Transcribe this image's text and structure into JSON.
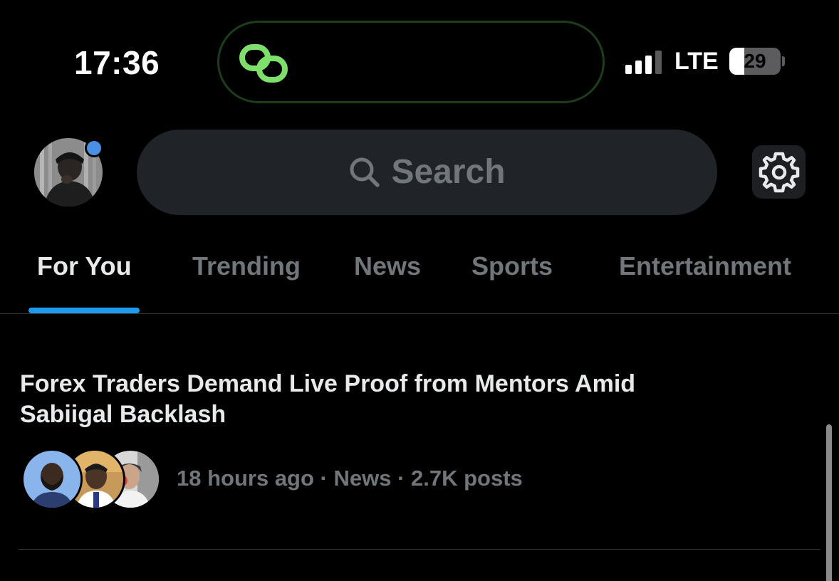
{
  "status_bar": {
    "time": "17:36",
    "network": "LTE",
    "battery_level": "29",
    "battery_fraction": 0.29,
    "signal_bars_active": 3,
    "signal_bars_total": 4,
    "live_activity_icon": "link-icon",
    "live_activity_color": "#7ee06a"
  },
  "header": {
    "avatar_icon": "profile-avatar",
    "notification_dot_color": "#4a90e2",
    "search": {
      "label": "Search",
      "icon": "search-icon"
    },
    "settings_icon": "gear-icon"
  },
  "tabs": {
    "items": [
      {
        "label": "For You",
        "active": true
      },
      {
        "label": "Trending",
        "active": false
      },
      {
        "label": "News",
        "active": false
      },
      {
        "label": "Sports",
        "active": false
      },
      {
        "label": "Entertainment",
        "active": false
      }
    ],
    "accent_color": "#1d9bf0"
  },
  "feed": {
    "items": [
      {
        "headline": "Forex Traders Demand Live Proof from Mentors Amid Sabiigal Backlash",
        "meta": "18 hours ago · News · 2.7K posts",
        "avatar_icons": [
          "person-avatar",
          "person-avatar",
          "person-avatar"
        ]
      }
    ]
  }
}
